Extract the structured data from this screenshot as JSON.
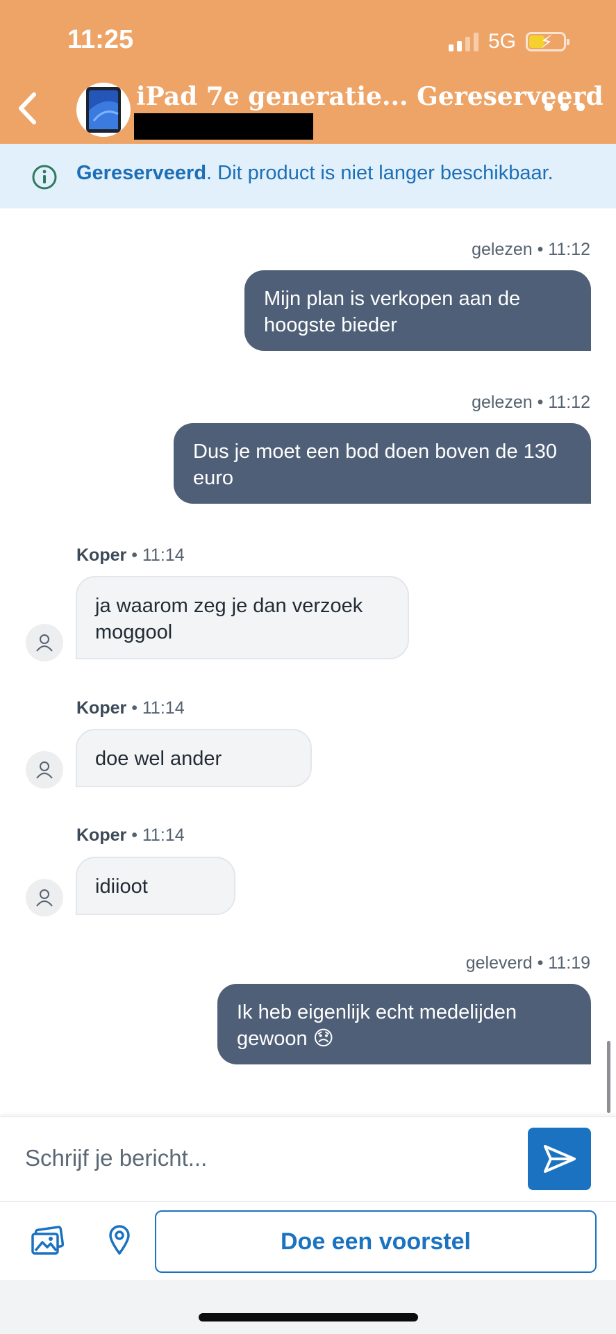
{
  "status_bar": {
    "time": "11:25",
    "network": "5G"
  },
  "header": {
    "title": "iPad 7e generatie... Gereserveerd"
  },
  "banner": {
    "status_bold": "Gereserveerd",
    "message": ". Dit product is niet langer beschikbaar."
  },
  "messages": [
    {
      "direction": "out",
      "meta": "gelezen • 11:12",
      "text": "Mijn plan is verkopen aan de hoogste bieder"
    },
    {
      "direction": "out",
      "meta": "gelezen • 11:12",
      "text": "Dus je moet een bod doen boven de 130 euro"
    },
    {
      "direction": "in",
      "sender": "Koper",
      "time": "• 11:14",
      "text": "ja waarom zeg je dan verzoek moggool"
    },
    {
      "direction": "in",
      "sender": "Koper",
      "time": "• 11:14",
      "text": "doe wel ander"
    },
    {
      "direction": "in",
      "sender": "Koper",
      "time": "• 11:14",
      "text": "idiioot"
    },
    {
      "direction": "out",
      "meta": "geleverd • 11:19",
      "text": "Ik heb eigenlijk echt medelijden gewoon 😞"
    }
  ],
  "composer": {
    "placeholder": "Schrijf je bericht..."
  },
  "actions": {
    "propose_label": "Doe een voorstel"
  },
  "icons": {
    "back": "chevron-left-icon",
    "more": "more-dots-icon",
    "info": "info-icon",
    "send": "send-icon",
    "photos": "photos-icon",
    "location": "location-pin-icon",
    "user": "user-icon"
  },
  "colors": {
    "header_bg": "#eea467",
    "banner_bg": "#e2f0fb",
    "accent": "#1a72c0",
    "outgoing_bubble": "#4e5f77",
    "incoming_bubble": "#f3f4f5"
  }
}
